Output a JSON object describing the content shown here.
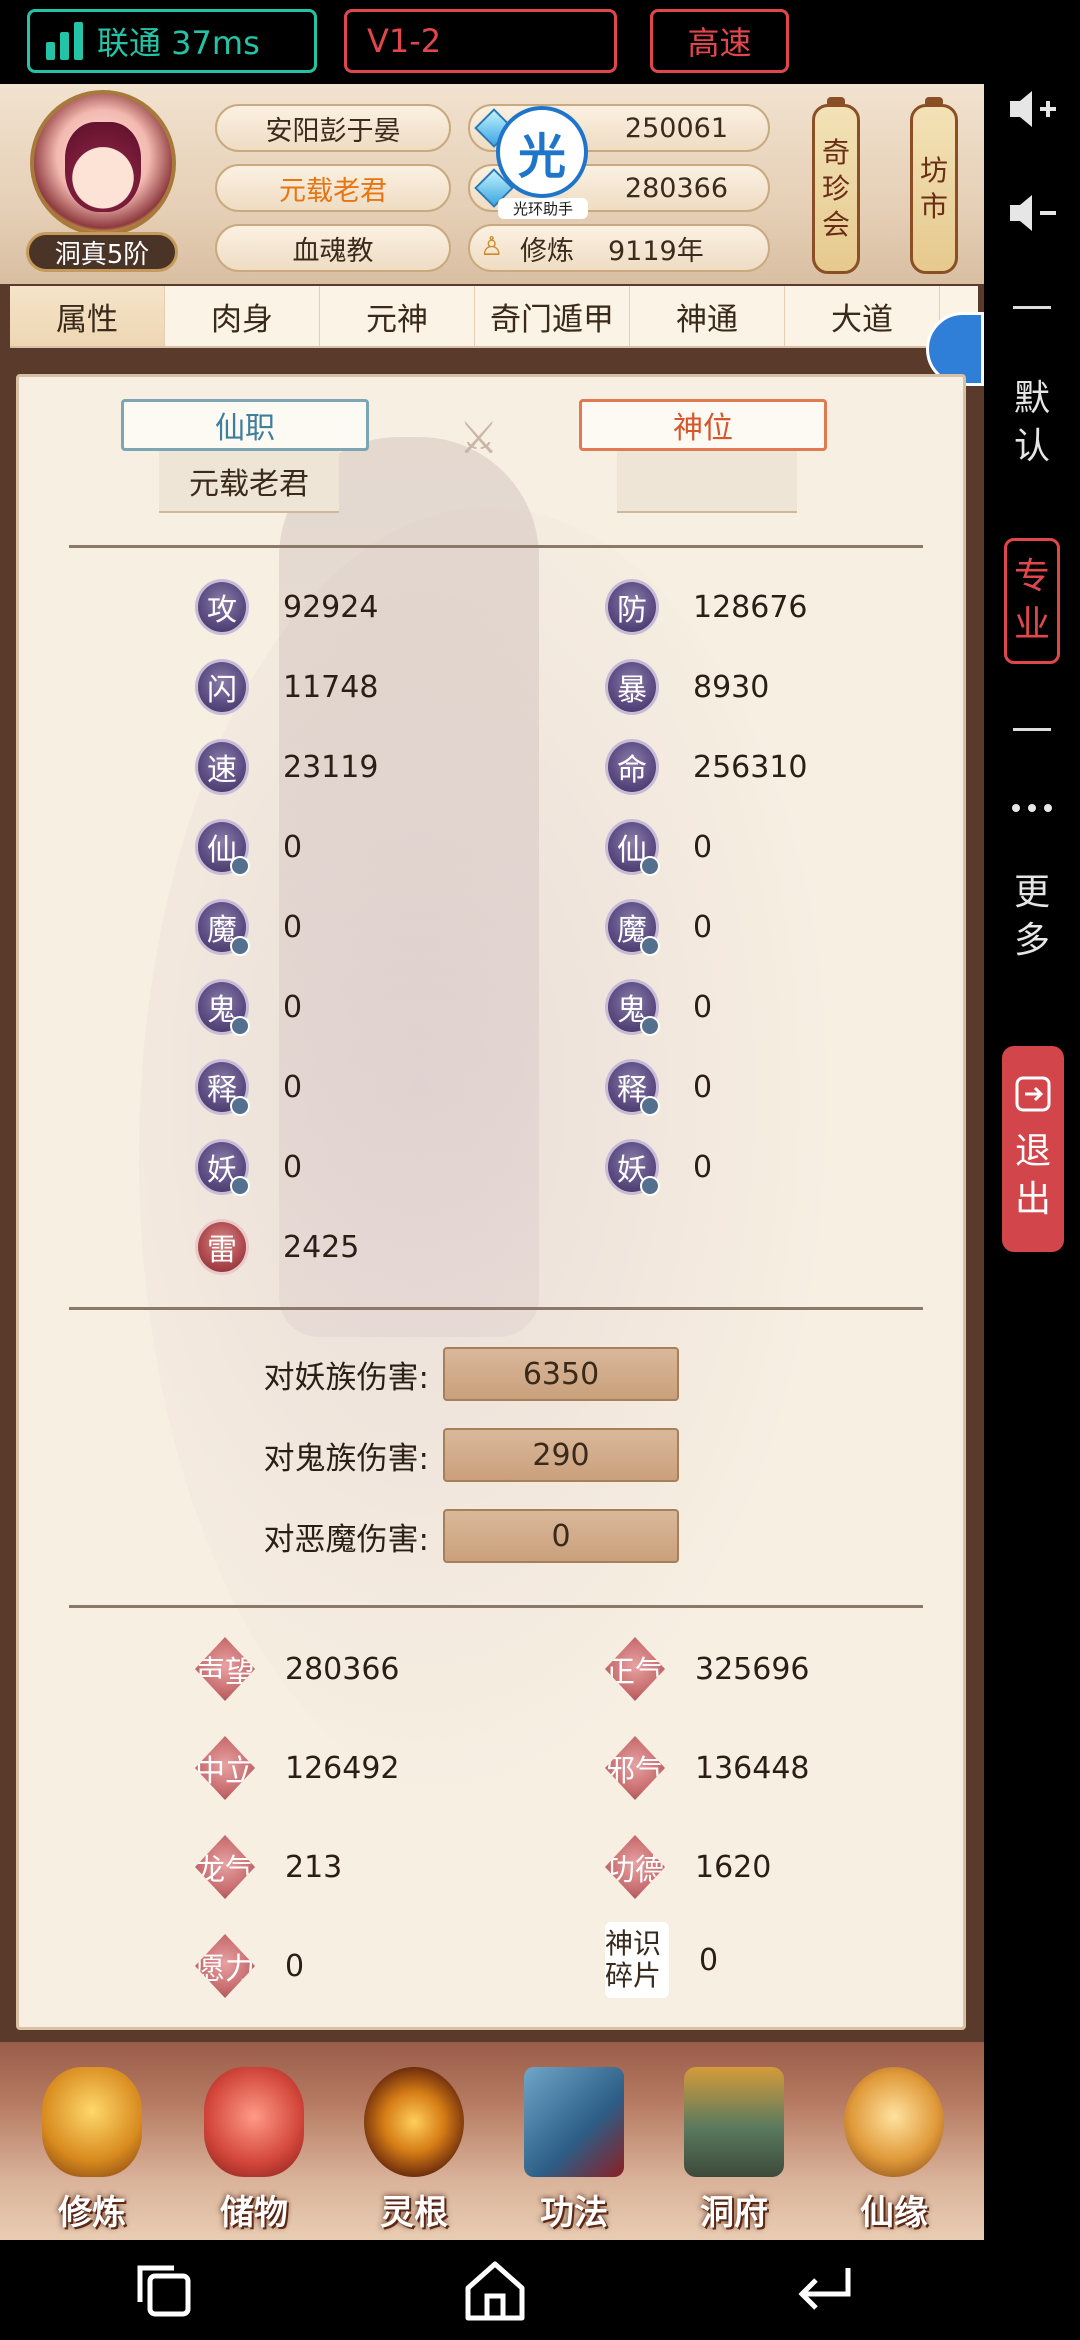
{
  "status": {
    "network": "联通 37ms",
    "version": "V1-2",
    "speed": "高速"
  },
  "sidebar": {
    "default_label": "默认",
    "pro_label": "专业",
    "more_label": "更多",
    "exit_label": "退出"
  },
  "header": {
    "rank": "洞真5阶",
    "name": "安阳彭于晏",
    "title": "元载老君",
    "sect": "血魂教",
    "value1": "250061",
    "value2": "280366",
    "cultivation_label": "修炼",
    "cultivation_value": "9119年",
    "helper_logo": "光",
    "helper_caption": "光环助手",
    "lantern_left": "奇珍会",
    "lantern_right": "坊市"
  },
  "tabs": [
    "属性",
    "肉身",
    "元神",
    "奇门遁甲",
    "神通",
    "大道"
  ],
  "panel": {
    "immortal_post_label": "仙职",
    "immortal_post_value": "元载老君",
    "divine_seat_label": "神位",
    "divine_seat_value": ""
  },
  "stats_left": [
    {
      "name": "攻",
      "value": "92924"
    },
    {
      "name": "闪",
      "value": "11748"
    },
    {
      "name": "速",
      "value": "23119"
    },
    {
      "name": "仙",
      "value": "0"
    },
    {
      "name": "魔",
      "value": "0"
    },
    {
      "name": "鬼",
      "value": "0"
    },
    {
      "name": "释",
      "value": "0"
    },
    {
      "name": "妖",
      "value": "0"
    },
    {
      "name": "雷",
      "value": "2425"
    }
  ],
  "stats_right": [
    {
      "name": "防",
      "value": "128676"
    },
    {
      "name": "暴",
      "value": "8930"
    },
    {
      "name": "命",
      "value": "256310"
    },
    {
      "name": "仙",
      "value": "0"
    },
    {
      "name": "魔",
      "value": "0"
    },
    {
      "name": "鬼",
      "value": "0"
    },
    {
      "name": "释",
      "value": "0"
    },
    {
      "name": "妖",
      "value": "0"
    }
  ],
  "damage": [
    {
      "label": "对妖族伤害:",
      "value": "6350"
    },
    {
      "label": "对鬼族伤害:",
      "value": "290"
    },
    {
      "label": "对恶魔伤害:",
      "value": "0"
    }
  ],
  "reputation_left": [
    {
      "name": "声望",
      "value": "280366"
    },
    {
      "name": "中立",
      "value": "126492"
    },
    {
      "name": "龙气",
      "value": "213"
    },
    {
      "name": "愿力",
      "value": "0"
    }
  ],
  "reputation_right": [
    {
      "name": "正气",
      "value": "325696"
    },
    {
      "name": "邪气",
      "value": "136448"
    },
    {
      "name": "功德",
      "value": "1620"
    },
    {
      "name": "神识碎片",
      "value": "0"
    }
  ],
  "menu": [
    "修炼",
    "储物",
    "灵根",
    "功法",
    "洞府",
    "仙缘"
  ],
  "colors": {
    "accent_teal": "#22c3a6",
    "accent_red": "#e0474c",
    "title_orange": "#e67512"
  }
}
